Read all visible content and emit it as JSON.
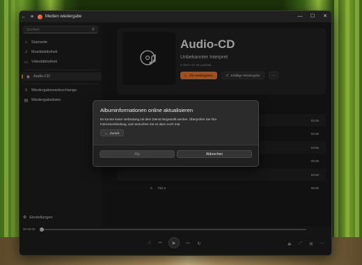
{
  "window": {
    "title": "Medien wiedergabe",
    "controls": {
      "minimize": "—",
      "maximize": "☐",
      "close": "✕"
    }
  },
  "sidebar": {
    "search_placeholder": "Suchen",
    "items": [
      {
        "label": "Startseite",
        "icon": "home-icon",
        "glyph": "⌂"
      },
      {
        "label": "Musikbibliothek",
        "icon": "music-icon",
        "glyph": "♫"
      },
      {
        "label": "Videobibliothek",
        "icon": "video-icon",
        "glyph": "▭"
      },
      {
        "label": "Audio-CD",
        "icon": "disc-icon",
        "glyph": "◉",
        "active": true
      },
      {
        "label": "Wiedergabewarteschlange",
        "icon": "queue-icon",
        "glyph": "≡"
      },
      {
        "label": "Wiedergabelisten",
        "icon": "playlist-icon",
        "glyph": "▤"
      }
    ],
    "settings_label": "Einstellungen"
  },
  "album": {
    "title": "Audio-CD",
    "artist": "Unbekannter Interpret",
    "meta": "6 Titel • 27:18 Laufzeit",
    "play_all": "Alle wiedergeben",
    "shuffle": "Zufällige Wiedergabe",
    "more": "···"
  },
  "tracks": [
    {
      "num": "",
      "name": "",
      "duration": "03:49"
    },
    {
      "num": "",
      "name": "",
      "duration": "03:36"
    },
    {
      "num": "",
      "name": "",
      "duration": "03:56"
    },
    {
      "num": "",
      "name": "",
      "duration": "05:05"
    },
    {
      "num": "",
      "name": "",
      "duration": "04:50"
    },
    {
      "num": "6.",
      "name": "Titel 6",
      "duration": "06:00"
    }
  ],
  "player": {
    "time_elapsed": "00:00:00",
    "time_total": "",
    "progress": 0
  },
  "dialog": {
    "title": "Albuminformationen online aktualisieren",
    "message": "Es konnte keine Verbindung mit dem Dienst hergestellt werden. Überprüfen Sie Ihre Internetverbindung, und versuchen Sie es dann noch mal.",
    "back_label": "Zurück",
    "primary_label": "Rip",
    "secondary_label": "Abbrechen"
  },
  "colors": {
    "accent": "#ff7a2e",
    "background": "#202020"
  }
}
